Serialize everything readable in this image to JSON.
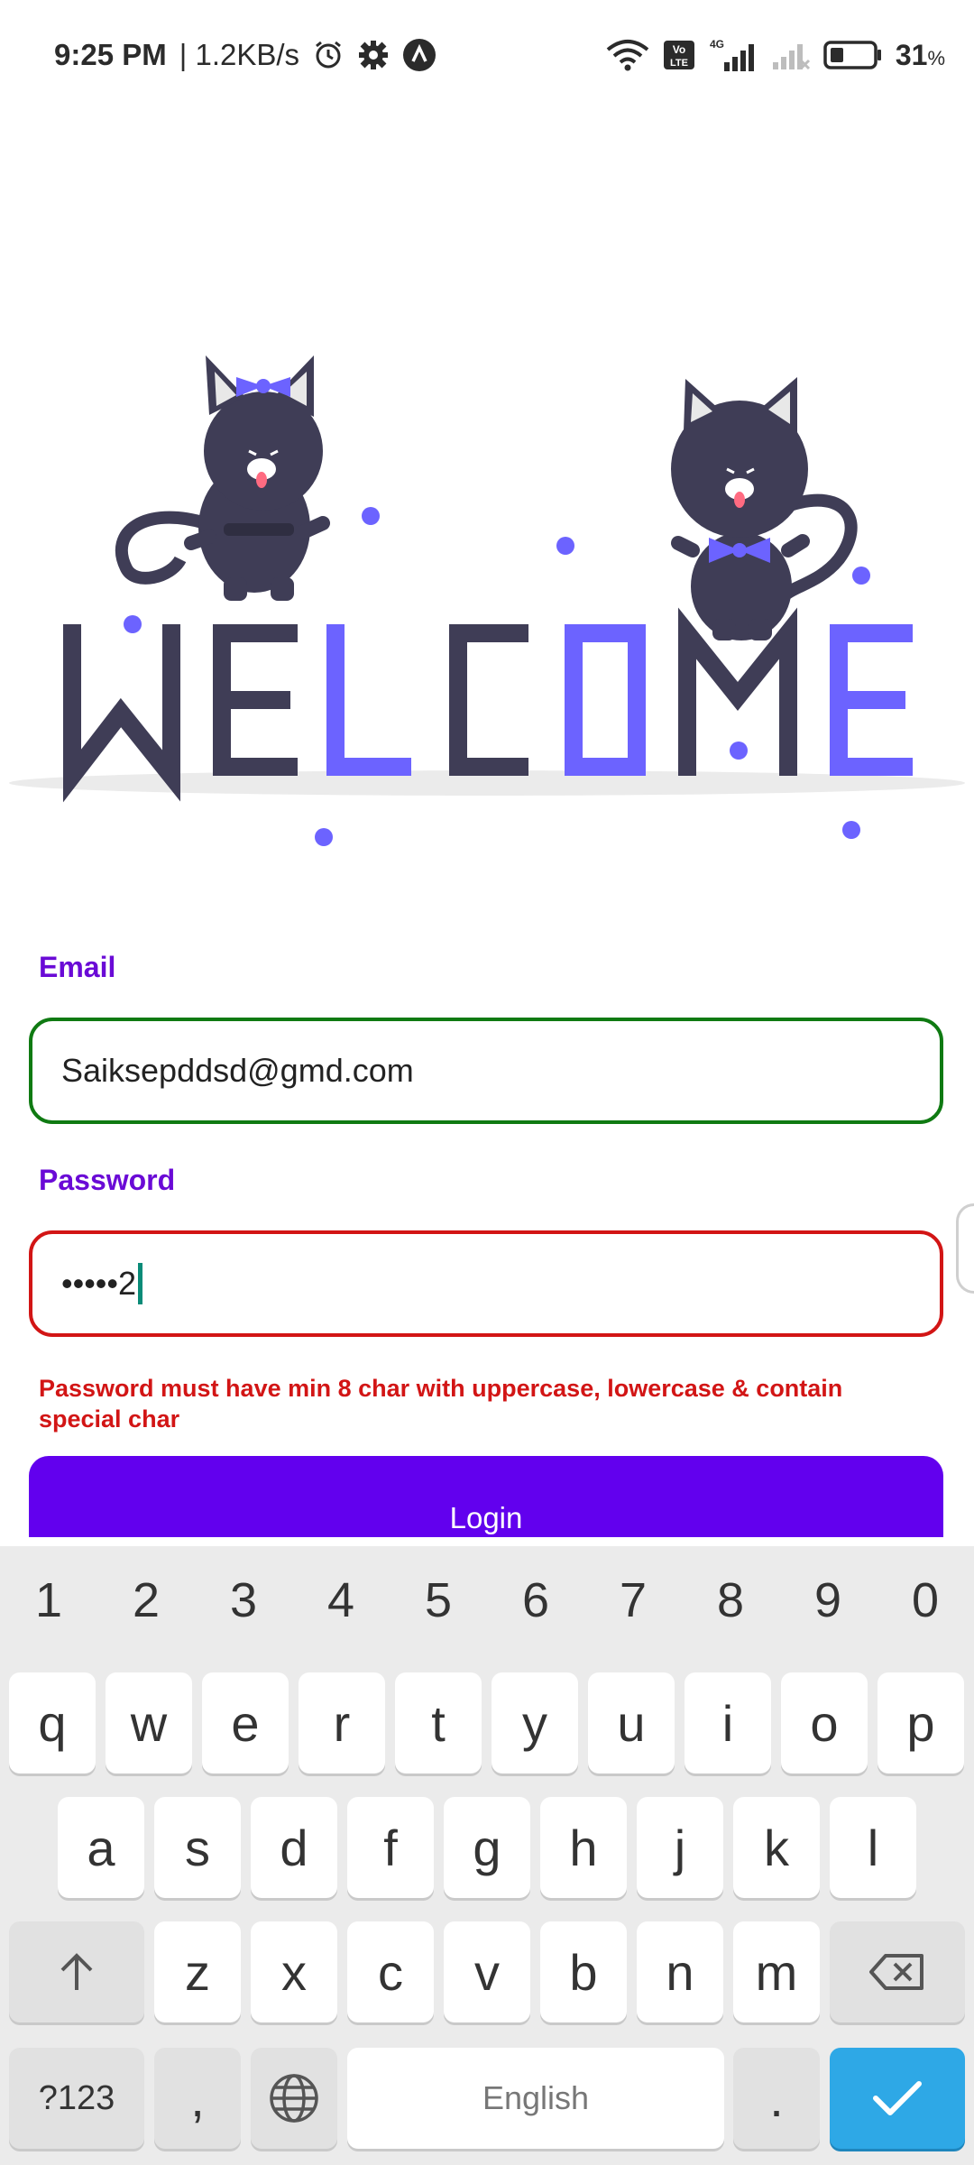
{
  "status_bar": {
    "time": "9:25 PM",
    "speed": "| 1.2KB/s",
    "network_type": "4G",
    "volte": "Vo LTE",
    "battery_level": "31",
    "battery_unit": "%"
  },
  "illustration": {
    "word": "WELCOME",
    "primary_color": "#3f3d56",
    "accent_color": "#6c63ff"
  },
  "form": {
    "email_label": "Email",
    "email_value": "Saiksepddsd@gmd.com",
    "password_label": "Password",
    "password_value": "•••••2",
    "error_text": "Password must have min 8 char with uppercase, lowercase & contain special char",
    "login_label": "Login"
  },
  "keyboard": {
    "numbers": [
      "1",
      "2",
      "3",
      "4",
      "5",
      "6",
      "7",
      "8",
      "9",
      "0"
    ],
    "row1": [
      "q",
      "w",
      "e",
      "r",
      "t",
      "y",
      "u",
      "i",
      "o",
      "p"
    ],
    "row2": [
      "a",
      "s",
      "d",
      "f",
      "g",
      "h",
      "j",
      "k",
      "l"
    ],
    "row3": [
      "z",
      "x",
      "c",
      "v",
      "b",
      "n",
      "m"
    ],
    "symbols_label": "?123",
    "comma": ",",
    "space_label": "English",
    "period": "."
  },
  "colors": {
    "email_border": "#0f7a12",
    "password_border": "#d21515",
    "label": "#6a0ad6",
    "button": "#6200ee",
    "done_key": "#2ea8e6"
  }
}
